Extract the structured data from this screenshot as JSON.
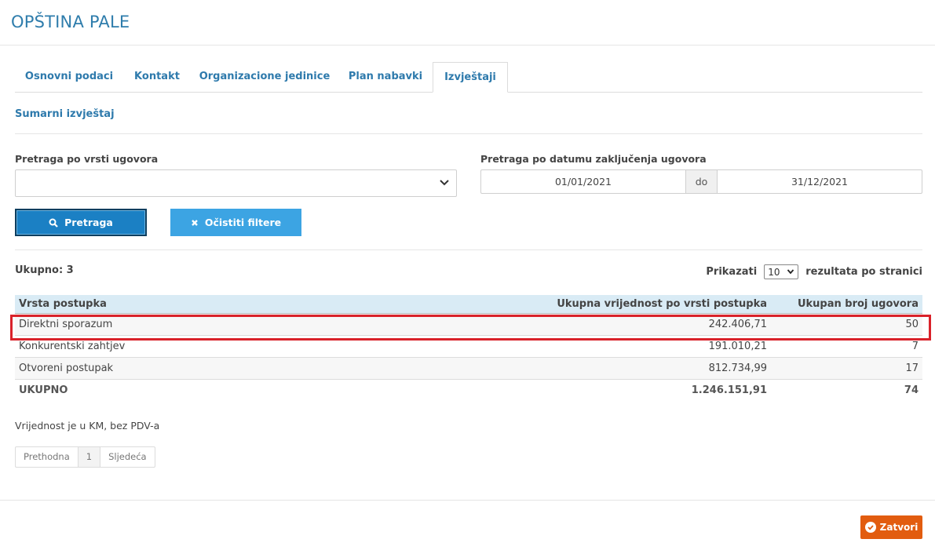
{
  "header": {
    "title": "OPŠTINA PALE"
  },
  "tabs": [
    {
      "label": "Osnovni podaci",
      "active": false
    },
    {
      "label": "Kontakt",
      "active": false
    },
    {
      "label": "Organizacione jedinice",
      "active": false
    },
    {
      "label": "Plan nabavki",
      "active": false
    },
    {
      "label": "Izvještaji",
      "active": true
    }
  ],
  "report": {
    "title": "Sumarni izvještaj"
  },
  "filters": {
    "contract_type_label": "Pretraga po vrsti ugovora",
    "contract_type_value": "",
    "date_label": "Pretraga po datumu zaključenja ugovora",
    "date_from": "01/01/2021",
    "date_separator": "do",
    "date_to": "31/12/2021"
  },
  "buttons": {
    "search": "Pretraga",
    "clear": "Očistiti filtere",
    "close": "Zatvori"
  },
  "summary": {
    "total_label": "Ukupno: 3",
    "show_label": "Prikazati",
    "page_size": "10",
    "per_page_label": "rezultata po stranici"
  },
  "table": {
    "headers": [
      "Vrsta postupka",
      "Ukupna vrijednost po vrsti postupka",
      "Ukupan broj ugovora"
    ],
    "rows": [
      [
        "Direktni sporazum",
        "242.406,71",
        "50"
      ],
      [
        "Konkurentski zahtjev",
        "191.010,21",
        "7"
      ],
      [
        "Otvoreni postupak",
        "812.734,99",
        "17"
      ]
    ],
    "total": [
      "UKUPNO",
      "1.246.151,91",
      "74"
    ],
    "highlighted_row": "Direktni sporazum"
  },
  "note": "Vrijednost je u KM, bez PDV-a",
  "pagination": {
    "prev": "Prethodna",
    "current": "1",
    "next": "Sljedeća"
  },
  "colors": {
    "brand": "#2f7dac",
    "search_button": "#1b80c4",
    "clear_button": "#3ca4e3",
    "close_button": "#e25c0f",
    "table_header": "#d9ebf5",
    "highlight": "#d9222a"
  },
  "icons": {
    "search": "search-icon",
    "clear": "close-icon",
    "close": "check-circle-icon",
    "select": "chevron-down-icon"
  }
}
